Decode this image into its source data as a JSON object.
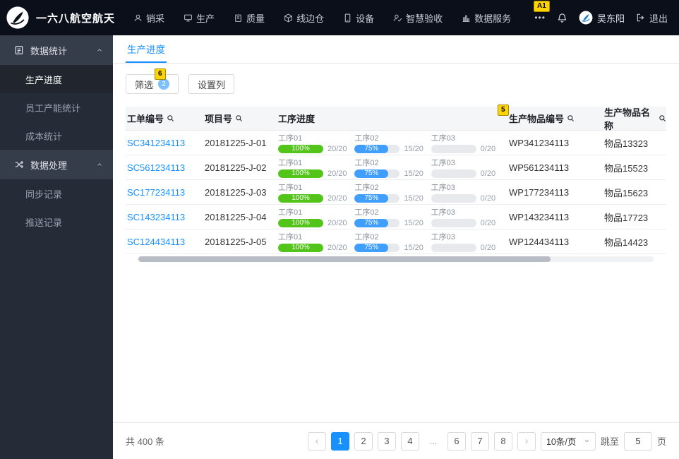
{
  "topbar": {
    "brand": "一六八航空航天",
    "nav": [
      {
        "label": "销采",
        "icon": "user-icon"
      },
      {
        "label": "生产",
        "icon": "monitor-icon"
      },
      {
        "label": "质量",
        "icon": "clipboard-icon"
      },
      {
        "label": "线边仓",
        "icon": "box-icon"
      },
      {
        "label": "设备",
        "icon": "device-icon"
      },
      {
        "label": "智慧验收",
        "icon": "user-check-icon"
      },
      {
        "label": "数据服务",
        "icon": "chart-icon"
      }
    ],
    "more": "•••",
    "user_name": "吴东阳",
    "logout": "退出"
  },
  "annotations": {
    "notification_mark": "A1",
    "filter_mark": "6",
    "column_mark": "5"
  },
  "sidebar": {
    "groups": [
      {
        "label": "数据统计",
        "icon": "stats-icon",
        "items": [
          {
            "label": "生产进度",
            "active": true
          },
          {
            "label": "员工产能统计",
            "active": false
          },
          {
            "label": "成本统计",
            "active": false
          }
        ]
      },
      {
        "label": "数据处理",
        "icon": "shuffle-icon",
        "items": [
          {
            "label": "同步记录",
            "active": false
          },
          {
            "label": "推送记录",
            "active": false
          }
        ]
      }
    ]
  },
  "main": {
    "tab": "生产进度",
    "filter_button": "筛选",
    "filter_badge": "2",
    "columns_button": "设置列"
  },
  "table": {
    "headers": [
      "工单编号",
      "项目号",
      "工序进度",
      "生产物品编号",
      "生产物品名称"
    ],
    "rows": [
      {
        "work_order": "SC341234113",
        "project": "20181225-J-01",
        "item_code": "WP341234113",
        "item_name": "物品13323",
        "processes": [
          {
            "label": "工序01",
            "percent_text": "100%",
            "percent": 100,
            "count": "20/20",
            "color": "green"
          },
          {
            "label": "工序02",
            "percent_text": "75%",
            "percent": 75,
            "count": "15/20",
            "color": "blue"
          },
          {
            "label": "工序03",
            "percent_text": "",
            "percent": 0,
            "count": "0/20",
            "color": "gray"
          }
        ]
      },
      {
        "work_order": "SC561234113",
        "project": "20181225-J-02",
        "item_code": "WP561234113",
        "item_name": "物品15523",
        "processes": [
          {
            "label": "工序01",
            "percent_text": "100%",
            "percent": 100,
            "count": "20/20",
            "color": "green"
          },
          {
            "label": "工序02",
            "percent_text": "75%",
            "percent": 75,
            "count": "15/20",
            "color": "blue"
          },
          {
            "label": "工序03",
            "percent_text": "",
            "percent": 0,
            "count": "0/20",
            "color": "gray"
          }
        ]
      },
      {
        "work_order": "SC177234113",
        "project": "20181225-J-03",
        "item_code": "WP177234113",
        "item_name": "物品15623",
        "processes": [
          {
            "label": "工序01",
            "percent_text": "100%",
            "percent": 100,
            "count": "20/20",
            "color": "green"
          },
          {
            "label": "工序02",
            "percent_text": "75%",
            "percent": 75,
            "count": "15/20",
            "color": "blue"
          },
          {
            "label": "工序03",
            "percent_text": "",
            "percent": 0,
            "count": "0/20",
            "color": "gray"
          }
        ]
      },
      {
        "work_order": "SC143234113",
        "project": "20181225-J-04",
        "item_code": "WP143234113",
        "item_name": "物品17723",
        "processes": [
          {
            "label": "工序01",
            "percent_text": "100%",
            "percent": 100,
            "count": "20/20",
            "color": "green"
          },
          {
            "label": "工序02",
            "percent_text": "75%",
            "percent": 75,
            "count": "15/20",
            "color": "blue"
          },
          {
            "label": "工序03",
            "percent_text": "",
            "percent": 0,
            "count": "0/20",
            "color": "gray"
          }
        ]
      },
      {
        "work_order": "SC124434113",
        "project": "20181225-J-05",
        "item_code": "WP124434113",
        "item_name": "物品14423",
        "processes": [
          {
            "label": "工序01",
            "percent_text": "100%",
            "percent": 100,
            "count": "20/20",
            "color": "green"
          },
          {
            "label": "工序02",
            "percent_text": "75%",
            "percent": 75,
            "count": "15/20",
            "color": "blue"
          },
          {
            "label": "工序03",
            "percent_text": "",
            "percent": 0,
            "count": "0/20",
            "color": "gray"
          }
        ]
      }
    ]
  },
  "pagination": {
    "total": "共 400 条",
    "prev": "‹",
    "next": "›",
    "pages": [
      "1",
      "2",
      "3",
      "4",
      "...",
      "6",
      "7",
      "8"
    ],
    "active_page": "1",
    "page_size": "10条/页",
    "jump_label": "跳至",
    "jump_value": "5",
    "jump_suffix": "页"
  },
  "colors": {
    "accent_blue": "#1890ff",
    "progress_green": "#52c41a",
    "progress_blue": "#409eff",
    "empty_track": "#e7e9ed",
    "annotation_yellow": "#ffd400",
    "topbar_bg": "#0a0f1a",
    "sidebar_bg": "#262c37"
  }
}
